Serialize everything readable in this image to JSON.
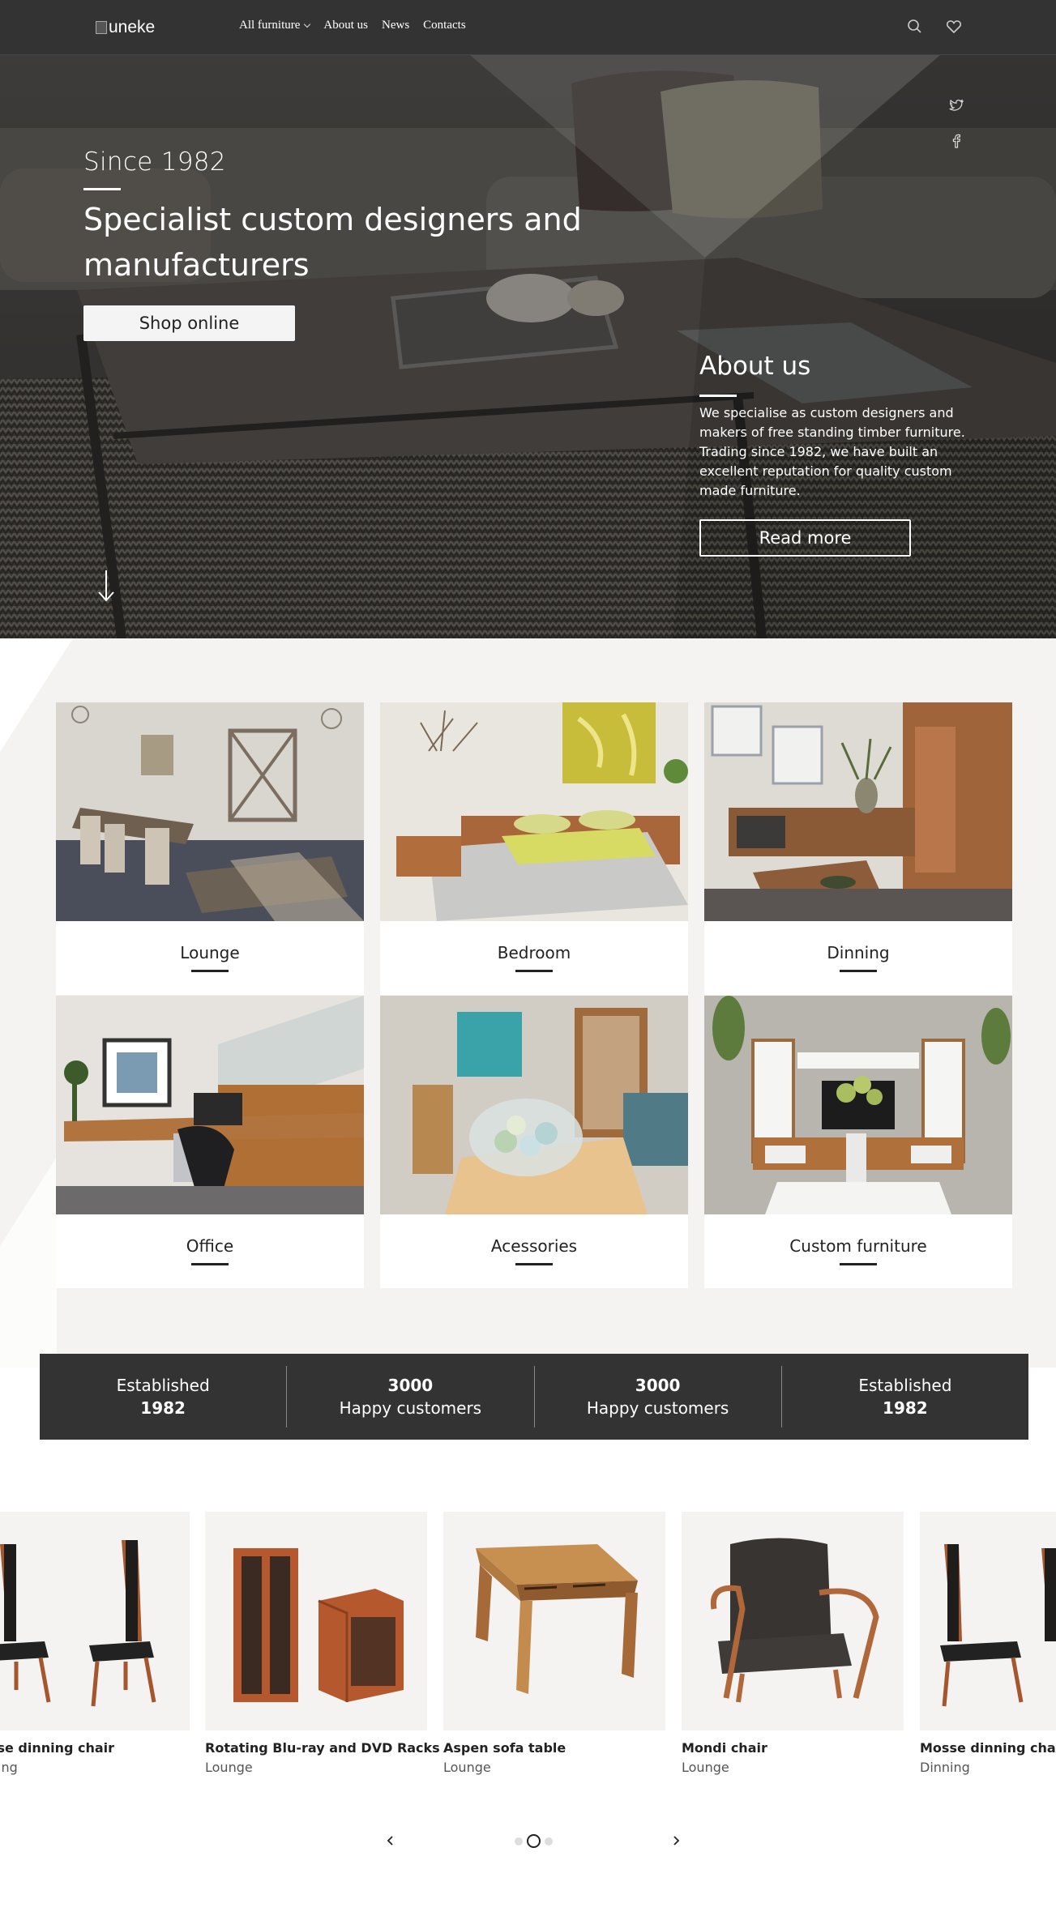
{
  "header": {
    "logo_text": "uneke",
    "nav": [
      "All furniture",
      "About us",
      "News",
      "Contacts"
    ]
  },
  "hero": {
    "since": "Since 1982",
    "title": "Specialist custom designers and manufacturers",
    "shop_label": "Shop online",
    "about_title": "About us",
    "about_text": "We specialise as custom designers and makers of free standing timber furniture. Trading since 1982, we have built an excellent reputation for quality custom made furniture.",
    "read_more": "Read more"
  },
  "categories": [
    "Lounge",
    "Bedroom",
    "Dinning",
    "Office",
    "Acessories",
    "Custom furniture"
  ],
  "stats": [
    {
      "line1": "Established",
      "line2": "1982"
    },
    {
      "line1": "3000",
      "line2": "Happy customers"
    },
    {
      "line1": "3000",
      "line2": "Happy customers"
    },
    {
      "line1": "Established",
      "line2": "1982"
    }
  ],
  "products": [
    {
      "name": "Mosse dinning chair",
      "category": "Dinning"
    },
    {
      "name": "Rotating Blu-ray and DVD Racks",
      "category": "Lounge"
    },
    {
      "name": "Aspen sofa table",
      "category": "Lounge"
    },
    {
      "name": "Mondi chair",
      "category": "Lounge"
    },
    {
      "name": "Mosse dinning chair",
      "category": "Dinning"
    }
  ],
  "carousel": {
    "total_dots": 3,
    "active_dot": 2
  },
  "icons": [
    "search-icon",
    "heart-icon",
    "twitter-icon",
    "facebook-icon",
    "arrow-down-icon",
    "chevron-left-icon",
    "chevron-right-icon"
  ],
  "colors": {
    "header_bg": "#333333",
    "section_bg": "#f4f3f1",
    "stats_bg": "#333333"
  }
}
